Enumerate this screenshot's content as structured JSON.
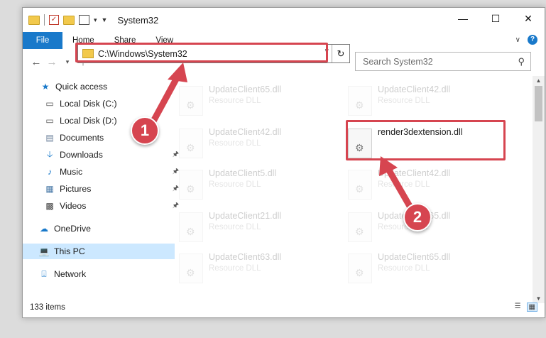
{
  "window": {
    "title": "System32"
  },
  "ribbon": {
    "file": "File",
    "tabs": [
      "Home",
      "Share",
      "View"
    ],
    "help": "?"
  },
  "address": {
    "path": "C:\\Windows\\System32"
  },
  "search": {
    "placeholder": "Search System32"
  },
  "sidebar": {
    "items": [
      {
        "label": "Quick access",
        "icon": "star-icon",
        "pinned": false
      },
      {
        "label": "Local Disk (C:)",
        "icon": "drive-icon",
        "pinned": false
      },
      {
        "label": "Local Disk (D:)",
        "icon": "drive-icon",
        "pinned": false
      },
      {
        "label": "Documents",
        "icon": "documents-icon",
        "pinned": false
      },
      {
        "label": "Downloads",
        "icon": "download-icon",
        "pinned": true
      },
      {
        "label": "Music",
        "icon": "music-icon",
        "pinned": true
      },
      {
        "label": "Pictures",
        "icon": "pictures-icon",
        "pinned": true
      },
      {
        "label": "Videos",
        "icon": "videos-icon",
        "pinned": true
      },
      {
        "label": "OneDrive",
        "icon": "cloud-icon",
        "pinned": false
      },
      {
        "label": "This PC",
        "icon": "computer-icon",
        "pinned": false
      },
      {
        "label": "Network",
        "icon": "network-icon",
        "pinned": false
      }
    ]
  },
  "files": {
    "left": [
      {
        "name": "UpdateClient65.dll",
        "type": "Resource DLL"
      },
      {
        "name": "UpdateClient42.dll",
        "type": "Resource DLL"
      },
      {
        "name": "UpdateClient5.dll",
        "type": "Resource DLL"
      },
      {
        "name": "UpdateClient21.dll",
        "type": "Resource DLL"
      },
      {
        "name": "UpdateClient63.dll",
        "type": "Resource DLL"
      }
    ],
    "right": [
      {
        "name": "UpdateClient42.dll",
        "type": "Resource DLL"
      },
      {
        "name": "render3dextension.dll",
        "type": ""
      },
      {
        "name": "UpdateClient42.dll",
        "type": "Resource DLL"
      },
      {
        "name": "UpdateClient65.dll",
        "type": "Resource DLL"
      },
      {
        "name": "UpdateClient65.dll",
        "type": "Resource DLL"
      }
    ]
  },
  "status": {
    "count": "133 items"
  },
  "callouts": [
    "1",
    "2"
  ],
  "colors": {
    "accent": "#1979ca",
    "highlight": "#d64550",
    "selected": "#cce8ff"
  }
}
